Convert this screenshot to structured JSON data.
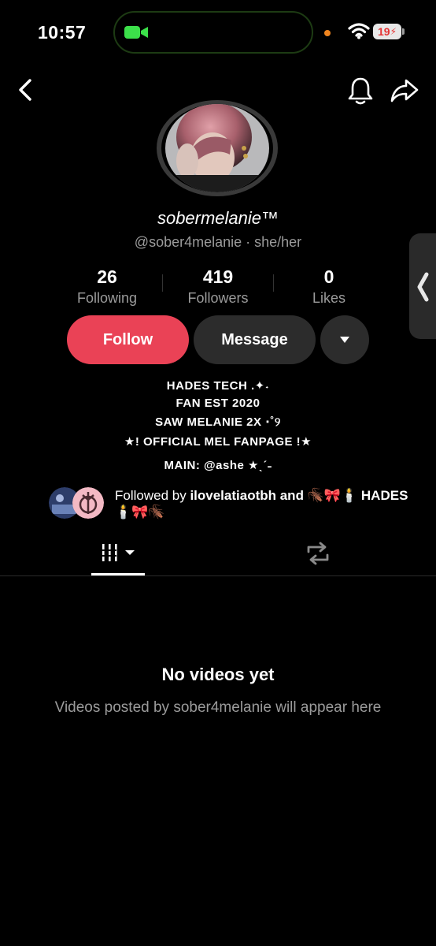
{
  "status_bar": {
    "time": "10:57",
    "battery": "19"
  },
  "profile": {
    "display_name": "sobermelanie™",
    "handle_line": "@sober4melanie · she/her"
  },
  "stats": [
    {
      "value": "26",
      "label": "Following"
    },
    {
      "value": "419",
      "label": "Followers"
    },
    {
      "value": "0",
      "label": "Likes"
    }
  ],
  "actions": {
    "follow": "Follow",
    "message": "Message"
  },
  "bio": [
    "HADES TECH .✦˖",
    "FAN EST 2020",
    "SAW MELANIE 2X ⋅˚୨",
    "★! OFFICIAL MEL FANPAGE !★",
    "MAIN: @ashe ★ˎˊ˗"
  ],
  "followed_by": {
    "prefix": "Followed by ",
    "names": "ilovelatiaotbh and 🪳🎀🕯️ HADES🕯️🎀🪳"
  },
  "empty_state": {
    "title": "No videos yet",
    "subtitle": "Videos posted by sober4melanie will appear here"
  },
  "colors": {
    "accent": "#ea4256",
    "button_dark": "#2c2c2c",
    "muted_text": "#9b9b9b"
  }
}
